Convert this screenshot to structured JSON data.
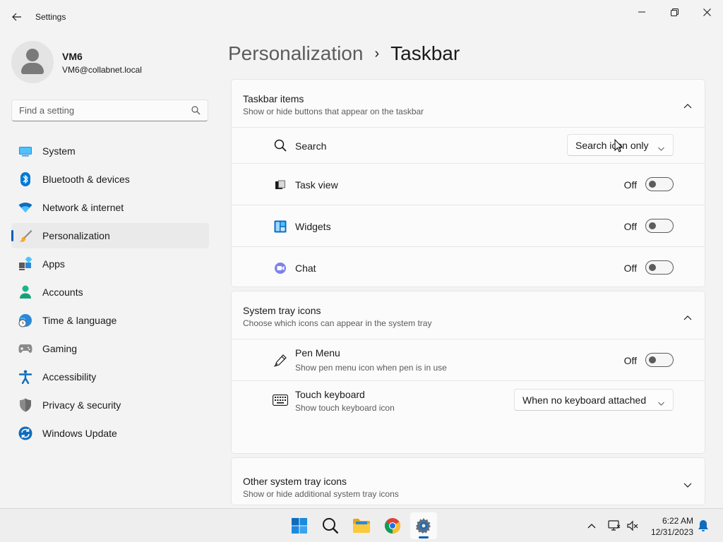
{
  "window": {
    "title": "Settings"
  },
  "user": {
    "name": "VM6",
    "email": "VM6@collabnet.local"
  },
  "search": {
    "placeholder": "Find a setting"
  },
  "sidebar": {
    "items": [
      {
        "label": "System",
        "icon": "system-icon",
        "active": false
      },
      {
        "label": "Bluetooth & devices",
        "icon": "bluetooth-icon",
        "active": false
      },
      {
        "label": "Network & internet",
        "icon": "wifi-icon",
        "active": false
      },
      {
        "label": "Personalization",
        "icon": "brush-icon",
        "active": true
      },
      {
        "label": "Apps",
        "icon": "apps-icon",
        "active": false
      },
      {
        "label": "Accounts",
        "icon": "accounts-icon",
        "active": false
      },
      {
        "label": "Time & language",
        "icon": "globe-clock-icon",
        "active": false
      },
      {
        "label": "Gaming",
        "icon": "gamepad-icon",
        "active": false
      },
      {
        "label": "Accessibility",
        "icon": "accessibility-icon",
        "active": false
      },
      {
        "label": "Privacy & security",
        "icon": "shield-icon",
        "active": false
      },
      {
        "label": "Windows Update",
        "icon": "update-icon",
        "active": false
      }
    ]
  },
  "breadcrumb": {
    "parent": "Personalization",
    "separator": "›",
    "current": "Taskbar"
  },
  "taskbar_items": {
    "title": "Taskbar items",
    "subtitle": "Show or hide buttons that appear on the taskbar",
    "rows": [
      {
        "label": "Search",
        "icon": "search-icon",
        "control": "dropdown",
        "value": "Search icon only"
      },
      {
        "label": "Task view",
        "icon": "task-view-icon",
        "control": "toggle",
        "state": "Off"
      },
      {
        "label": "Widgets",
        "icon": "widgets-icon",
        "control": "toggle",
        "state": "Off"
      },
      {
        "label": "Chat",
        "icon": "chat-icon",
        "control": "toggle",
        "state": "Off"
      }
    ]
  },
  "system_tray": {
    "title": "System tray icons",
    "subtitle": "Choose which icons can appear in the system tray",
    "rows": [
      {
        "label": "Pen Menu",
        "description": "Show pen menu icon when pen is in use",
        "icon": "pen-icon",
        "control": "toggle",
        "state": "Off"
      },
      {
        "label": "Touch keyboard",
        "description": "Show touch keyboard icon",
        "icon": "keyboard-icon",
        "control": "dropdown",
        "value": "When no keyboard attached"
      }
    ]
  },
  "other_tray": {
    "title": "Other system tray icons",
    "subtitle": "Show or hide additional system tray icons"
  },
  "taskbar": {
    "apps": [
      "start-icon",
      "search-icon",
      "file-explorer-icon",
      "chrome-icon",
      "settings-icon"
    ],
    "time": "6:22 AM",
    "date": "12/31/2023"
  },
  "colors": {
    "accent": "#005fb8",
    "background": "#f3f3f3",
    "card": "#fbfbfb"
  }
}
